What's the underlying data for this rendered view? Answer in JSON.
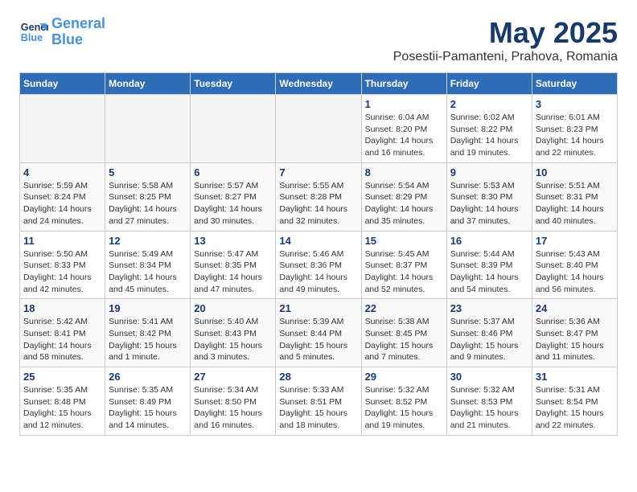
{
  "logo": {
    "line1": "General",
    "line2": "Blue"
  },
  "title": "May 2025",
  "subtitle": "Posestii-Pamanteni, Prahova, Romania",
  "headers": [
    "Sunday",
    "Monday",
    "Tuesday",
    "Wednesday",
    "Thursday",
    "Friday",
    "Saturday"
  ],
  "weeks": [
    [
      {
        "day": "",
        "info": ""
      },
      {
        "day": "",
        "info": ""
      },
      {
        "day": "",
        "info": ""
      },
      {
        "day": "",
        "info": ""
      },
      {
        "day": "1",
        "info": "Sunrise: 6:04 AM\nSunset: 8:20 PM\nDaylight: 14 hours\nand 16 minutes."
      },
      {
        "day": "2",
        "info": "Sunrise: 6:02 AM\nSunset: 8:22 PM\nDaylight: 14 hours\nand 19 minutes."
      },
      {
        "day": "3",
        "info": "Sunrise: 6:01 AM\nSunset: 8:23 PM\nDaylight: 14 hours\nand 22 minutes."
      }
    ],
    [
      {
        "day": "4",
        "info": "Sunrise: 5:59 AM\nSunset: 8:24 PM\nDaylight: 14 hours\nand 24 minutes."
      },
      {
        "day": "5",
        "info": "Sunrise: 5:58 AM\nSunset: 8:25 PM\nDaylight: 14 hours\nand 27 minutes."
      },
      {
        "day": "6",
        "info": "Sunrise: 5:57 AM\nSunset: 8:27 PM\nDaylight: 14 hours\nand 30 minutes."
      },
      {
        "day": "7",
        "info": "Sunrise: 5:55 AM\nSunset: 8:28 PM\nDaylight: 14 hours\nand 32 minutes."
      },
      {
        "day": "8",
        "info": "Sunrise: 5:54 AM\nSunset: 8:29 PM\nDaylight: 14 hours\nand 35 minutes."
      },
      {
        "day": "9",
        "info": "Sunrise: 5:53 AM\nSunset: 8:30 PM\nDaylight: 14 hours\nand 37 minutes."
      },
      {
        "day": "10",
        "info": "Sunrise: 5:51 AM\nSunset: 8:31 PM\nDaylight: 14 hours\nand 40 minutes."
      }
    ],
    [
      {
        "day": "11",
        "info": "Sunrise: 5:50 AM\nSunset: 8:33 PM\nDaylight: 14 hours\nand 42 minutes."
      },
      {
        "day": "12",
        "info": "Sunrise: 5:49 AM\nSunset: 8:34 PM\nDaylight: 14 hours\nand 45 minutes."
      },
      {
        "day": "13",
        "info": "Sunrise: 5:47 AM\nSunset: 8:35 PM\nDaylight: 14 hours\nand 47 minutes."
      },
      {
        "day": "14",
        "info": "Sunrise: 5:46 AM\nSunset: 8:36 PM\nDaylight: 14 hours\nand 49 minutes."
      },
      {
        "day": "15",
        "info": "Sunrise: 5:45 AM\nSunset: 8:37 PM\nDaylight: 14 hours\nand 52 minutes."
      },
      {
        "day": "16",
        "info": "Sunrise: 5:44 AM\nSunset: 8:39 PM\nDaylight: 14 hours\nand 54 minutes."
      },
      {
        "day": "17",
        "info": "Sunrise: 5:43 AM\nSunset: 8:40 PM\nDaylight: 14 hours\nand 56 minutes."
      }
    ],
    [
      {
        "day": "18",
        "info": "Sunrise: 5:42 AM\nSunset: 8:41 PM\nDaylight: 14 hours\nand 58 minutes."
      },
      {
        "day": "19",
        "info": "Sunrise: 5:41 AM\nSunset: 8:42 PM\nDaylight: 15 hours\nand 1 minute."
      },
      {
        "day": "20",
        "info": "Sunrise: 5:40 AM\nSunset: 8:43 PM\nDaylight: 15 hours\nand 3 minutes."
      },
      {
        "day": "21",
        "info": "Sunrise: 5:39 AM\nSunset: 8:44 PM\nDaylight: 15 hours\nand 5 minutes."
      },
      {
        "day": "22",
        "info": "Sunrise: 5:38 AM\nSunset: 8:45 PM\nDaylight: 15 hours\nand 7 minutes."
      },
      {
        "day": "23",
        "info": "Sunrise: 5:37 AM\nSunset: 8:46 PM\nDaylight: 15 hours\nand 9 minutes."
      },
      {
        "day": "24",
        "info": "Sunrise: 5:36 AM\nSunset: 8:47 PM\nDaylight: 15 hours\nand 11 minutes."
      }
    ],
    [
      {
        "day": "25",
        "info": "Sunrise: 5:35 AM\nSunset: 8:48 PM\nDaylight: 15 hours\nand 12 minutes."
      },
      {
        "day": "26",
        "info": "Sunrise: 5:35 AM\nSunset: 8:49 PM\nDaylight: 15 hours\nand 14 minutes."
      },
      {
        "day": "27",
        "info": "Sunrise: 5:34 AM\nSunset: 8:50 PM\nDaylight: 15 hours\nand 16 minutes."
      },
      {
        "day": "28",
        "info": "Sunrise: 5:33 AM\nSunset: 8:51 PM\nDaylight: 15 hours\nand 18 minutes."
      },
      {
        "day": "29",
        "info": "Sunrise: 5:32 AM\nSunset: 8:52 PM\nDaylight: 15 hours\nand 19 minutes."
      },
      {
        "day": "30",
        "info": "Sunrise: 5:32 AM\nSunset: 8:53 PM\nDaylight: 15 hours\nand 21 minutes."
      },
      {
        "day": "31",
        "info": "Sunrise: 5:31 AM\nSunset: 8:54 PM\nDaylight: 15 hours\nand 22 minutes."
      }
    ]
  ]
}
